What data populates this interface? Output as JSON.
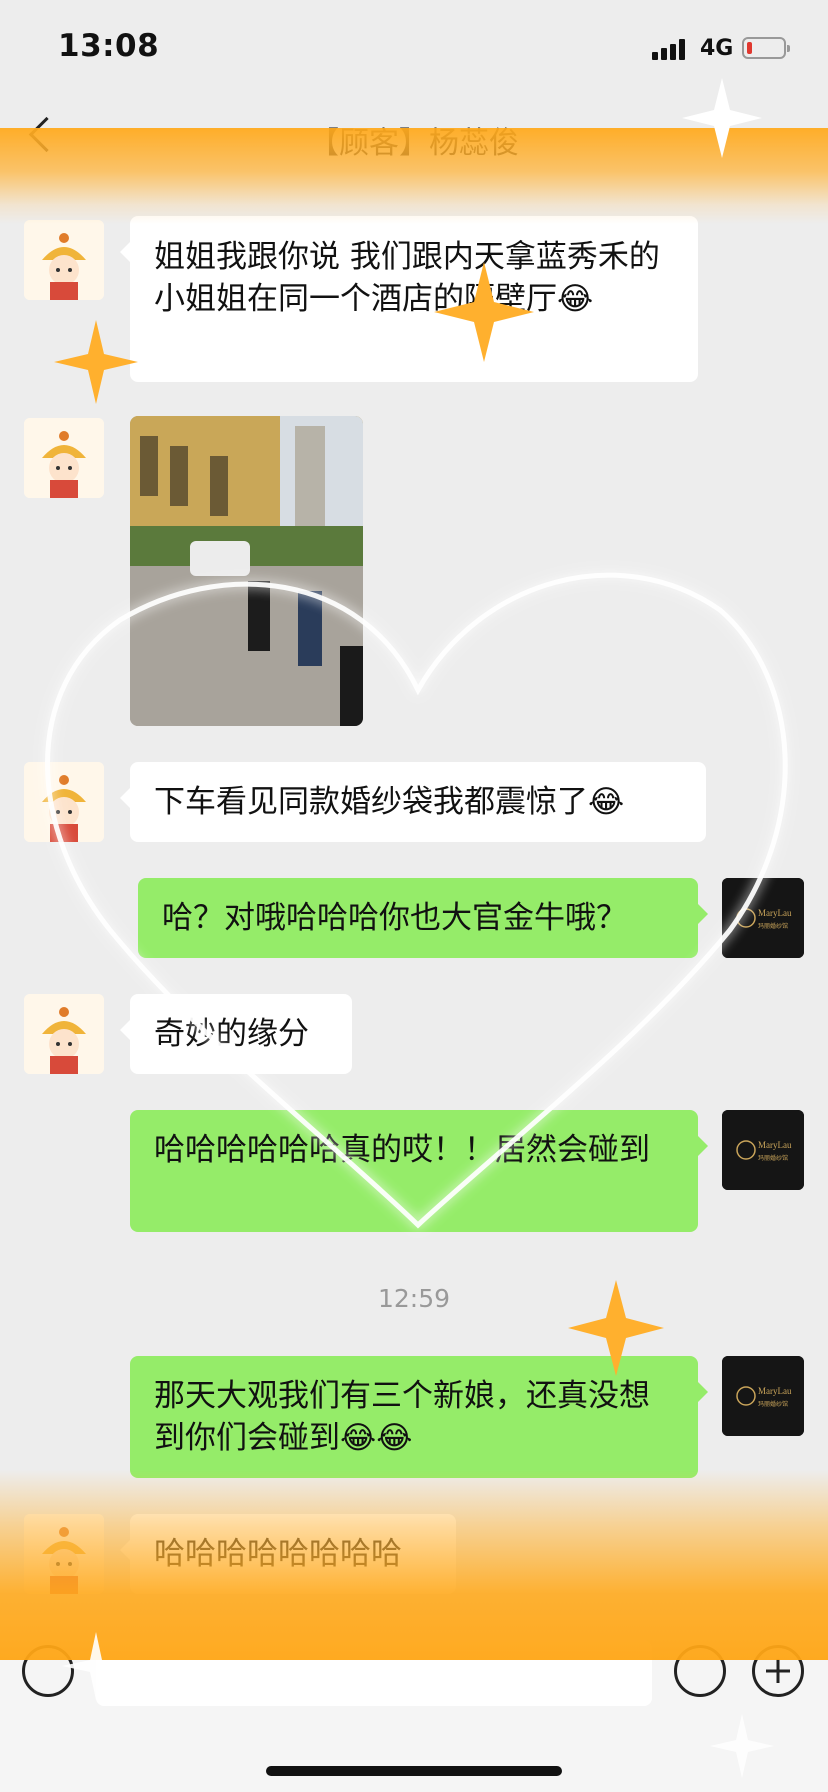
{
  "status_bar": {
    "time": "13:08",
    "network": "4G"
  },
  "nav": {
    "title": "【顾客】杨蕊俊"
  },
  "messages": [
    {
      "side": "in",
      "text": "姐姐我跟你说 我们跟内天拿蓝秀禾的小姐姐在同一个酒店的隔壁厅😂"
    },
    {
      "side": "in",
      "type": "image"
    },
    {
      "side": "in",
      "text": "下车看见同款婚纱袋我都震惊了😂"
    },
    {
      "side": "out",
      "text": "哈？对哦哈哈哈你也大官金牛哦？"
    },
    {
      "side": "in",
      "text": "奇妙的缘分"
    },
    {
      "side": "out",
      "text": "哈哈哈哈哈哈真的哎！！居然会碰到"
    },
    {
      "side": "out",
      "text": "那天大观我们有三个新娘，还真没想到你们会碰到😂😂"
    },
    {
      "side": "in",
      "text": "哈哈哈哈哈哈哈哈"
    }
  ],
  "timestamp": "12:59",
  "contact_avatar": {
    "brand": "MaryLau",
    "sub": "玛丽婚纱馆"
  },
  "colors": {
    "incoming_bubble": "#ffffff",
    "outgoing_bubble": "#95ec69",
    "background": "#ededed",
    "overlay": "#ffb22e"
  },
  "icons": [
    "back-icon",
    "voice-icon",
    "emoji-icon",
    "plus-icon",
    "signal-icon",
    "battery-icon"
  ]
}
